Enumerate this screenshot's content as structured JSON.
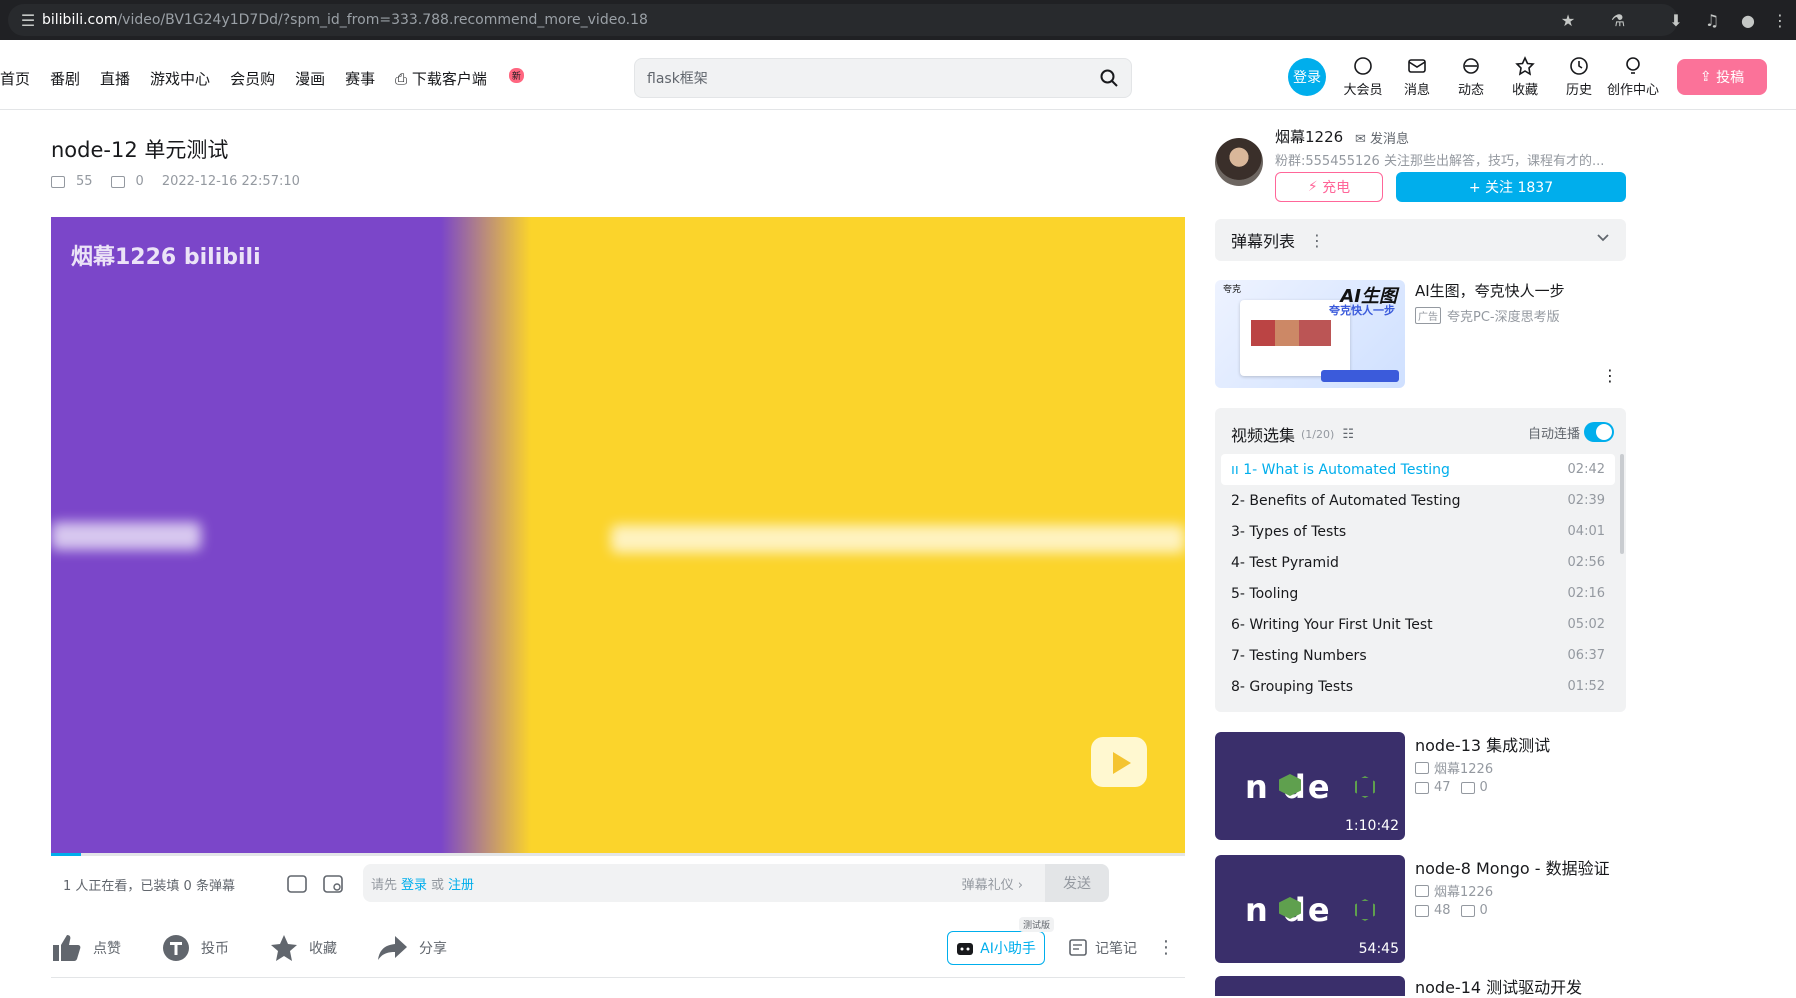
{
  "browser": {
    "url_domain": "bilibili.com",
    "url_path": "/video/BV1G24y1D7Dd/?spm_id_from=333.788.recommend_more_video.18"
  },
  "header": {
    "nav": [
      "首页",
      "番剧",
      "直播",
      "游戏中心",
      "会员购",
      "漫画",
      "赛事",
      "下载客户端"
    ],
    "new_badge": "新",
    "search_placeholder": "flask框架",
    "login": "登录",
    "icons": [
      {
        "label": "大会员",
        "icon": "vip-icon"
      },
      {
        "label": "消息",
        "icon": "message-icon"
      },
      {
        "label": "动态",
        "icon": "dynamic-icon"
      },
      {
        "label": "收藏",
        "icon": "favorite-icon"
      },
      {
        "label": "历史",
        "icon": "history-icon"
      },
      {
        "label": "创作中心",
        "icon": "creator-icon"
      }
    ],
    "upload": "投稿"
  },
  "video": {
    "title": "node-12 单元测试",
    "views": "55",
    "danmaku_count": "0",
    "date": "2022-12-16 22:57:10",
    "watermark": "烟幕1226 bilibili"
  },
  "danmaku_bar": {
    "watching": "1 人正在看，已装填 0 条弹幕",
    "prompt_prefix": "请先",
    "login": "登录",
    "or": "或",
    "register": "注册",
    "gift": "弹幕礼仪 ›",
    "send": "发送"
  },
  "actions": {
    "like": "点赞",
    "coin": "投币",
    "favorite": "收藏",
    "share": "分享",
    "ai": "AI小助手",
    "ai_tag": "测试版",
    "note": "记笔记"
  },
  "uploader": {
    "name": "烟幕1226",
    "message": "发消息",
    "desc": "粉群:555455126 关注那些出解答，技巧，课程有才的...",
    "charge": "充电",
    "follow": "+ 关注 1837"
  },
  "danmaku_list": {
    "label": "弹幕列表"
  },
  "ad": {
    "title": "AI生图，夸克快人一步",
    "tag": "广告",
    "sub": "夸克PC-深度思考版",
    "thumb_big": "AI生图",
    "thumb_small": "夸克快人一步",
    "thumb_brand": "夸克"
  },
  "playlist": {
    "title": "视频选集",
    "count": "(1/20)",
    "autoplay": "自动连播",
    "items": [
      {
        "title": "1- What is Automated Testing",
        "duration": "02:42"
      },
      {
        "title": "2- Benefits of Automated Testing",
        "duration": "02:39"
      },
      {
        "title": "3- Types of Tests",
        "duration": "04:01"
      },
      {
        "title": "4- Test Pyramid",
        "duration": "02:56"
      },
      {
        "title": "5- Tooling",
        "duration": "02:16"
      },
      {
        "title": "6- Writing Your First Unit Test",
        "duration": "05:02"
      },
      {
        "title": "7- Testing Numbers",
        "duration": "06:37"
      },
      {
        "title": "8- Grouping Tests",
        "duration": "01:52"
      }
    ]
  },
  "recommendations": [
    {
      "title": "node-13 集成测试",
      "up": "烟幕1226",
      "views": "47",
      "danmaku": "0",
      "duration": "1:10:42"
    },
    {
      "title": "node-8 Mongo - 数据验证",
      "up": "烟幕1226",
      "views": "48",
      "danmaku": "0",
      "duration": "54:45"
    },
    {
      "title": "node-14 测试驱动开发",
      "up": "",
      "views": "",
      "danmaku": "",
      "duration": ""
    }
  ]
}
